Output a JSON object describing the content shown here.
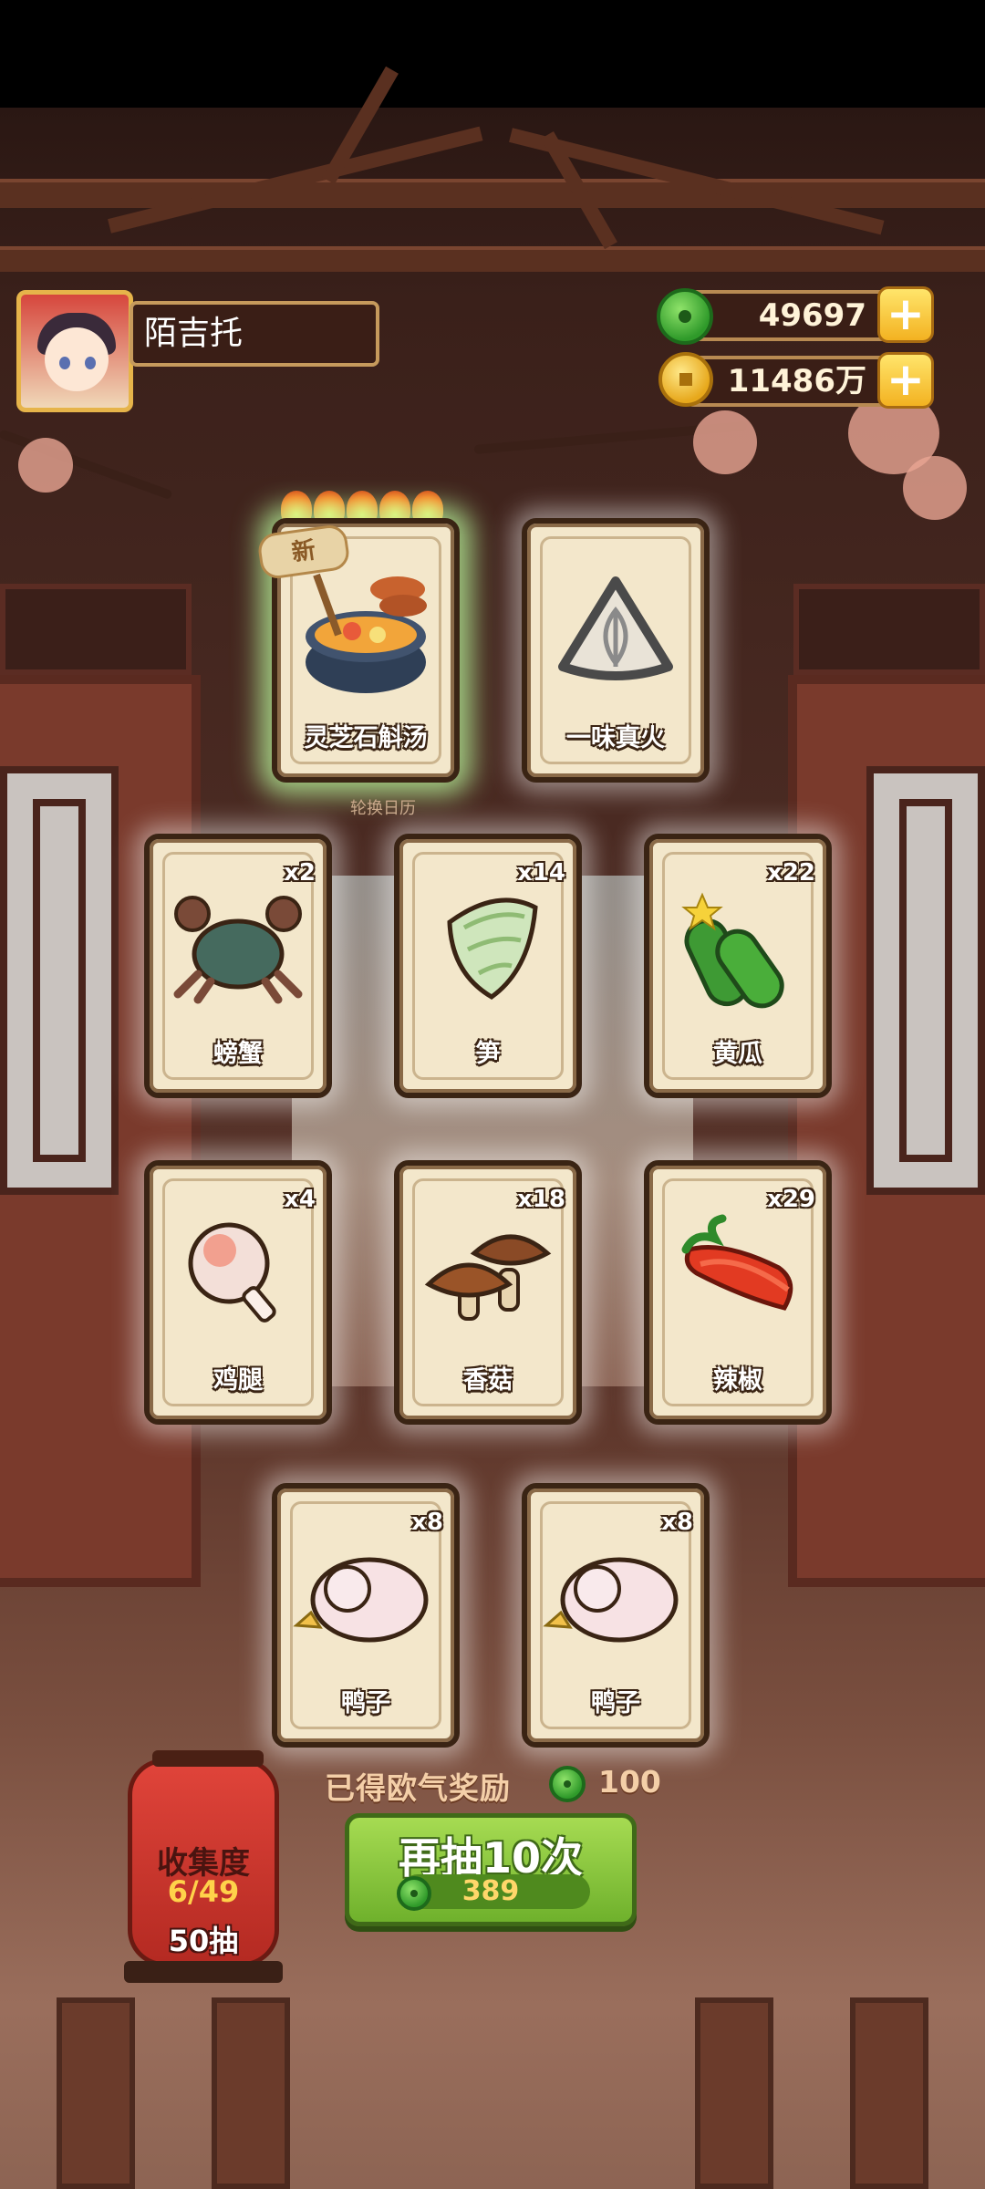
{
  "player": {
    "name": "陌吉托"
  },
  "currency": {
    "jade": {
      "value": "49697",
      "icon": "jade-coin-icon"
    },
    "gold": {
      "value": "11486万",
      "icon": "gold-coin-icon"
    },
    "plus": "+"
  },
  "featured": [
    {
      "name": "灵芝石斛汤",
      "tag": "新",
      "rare": true
    },
    {
      "name": "一味真火",
      "rare": false
    }
  ],
  "calendar_label": "轮换日历",
  "cards": [
    {
      "name": "螃蟹",
      "count": "x2"
    },
    {
      "name": "笋",
      "count": "x14"
    },
    {
      "name": "黄瓜",
      "count": "x22"
    },
    {
      "name": "鸡腿",
      "count": "x4"
    },
    {
      "name": "香菇",
      "count": "x18"
    },
    {
      "name": "辣椒",
      "count": "x29"
    },
    {
      "name": "鸭子",
      "count": "x8"
    },
    {
      "name": "鸭子",
      "count": "x8"
    }
  ],
  "reward": {
    "label": "已得欧气奖励",
    "value": "100"
  },
  "draw_button": {
    "label": "再抽10次",
    "cost": "389"
  },
  "collection": {
    "title": "收集度",
    "progress": "6/49",
    "draws": "50抽"
  },
  "colors": {
    "accent_green": "#6fb12c",
    "gold": "#f3b221",
    "lantern_red": "#d23a30"
  }
}
